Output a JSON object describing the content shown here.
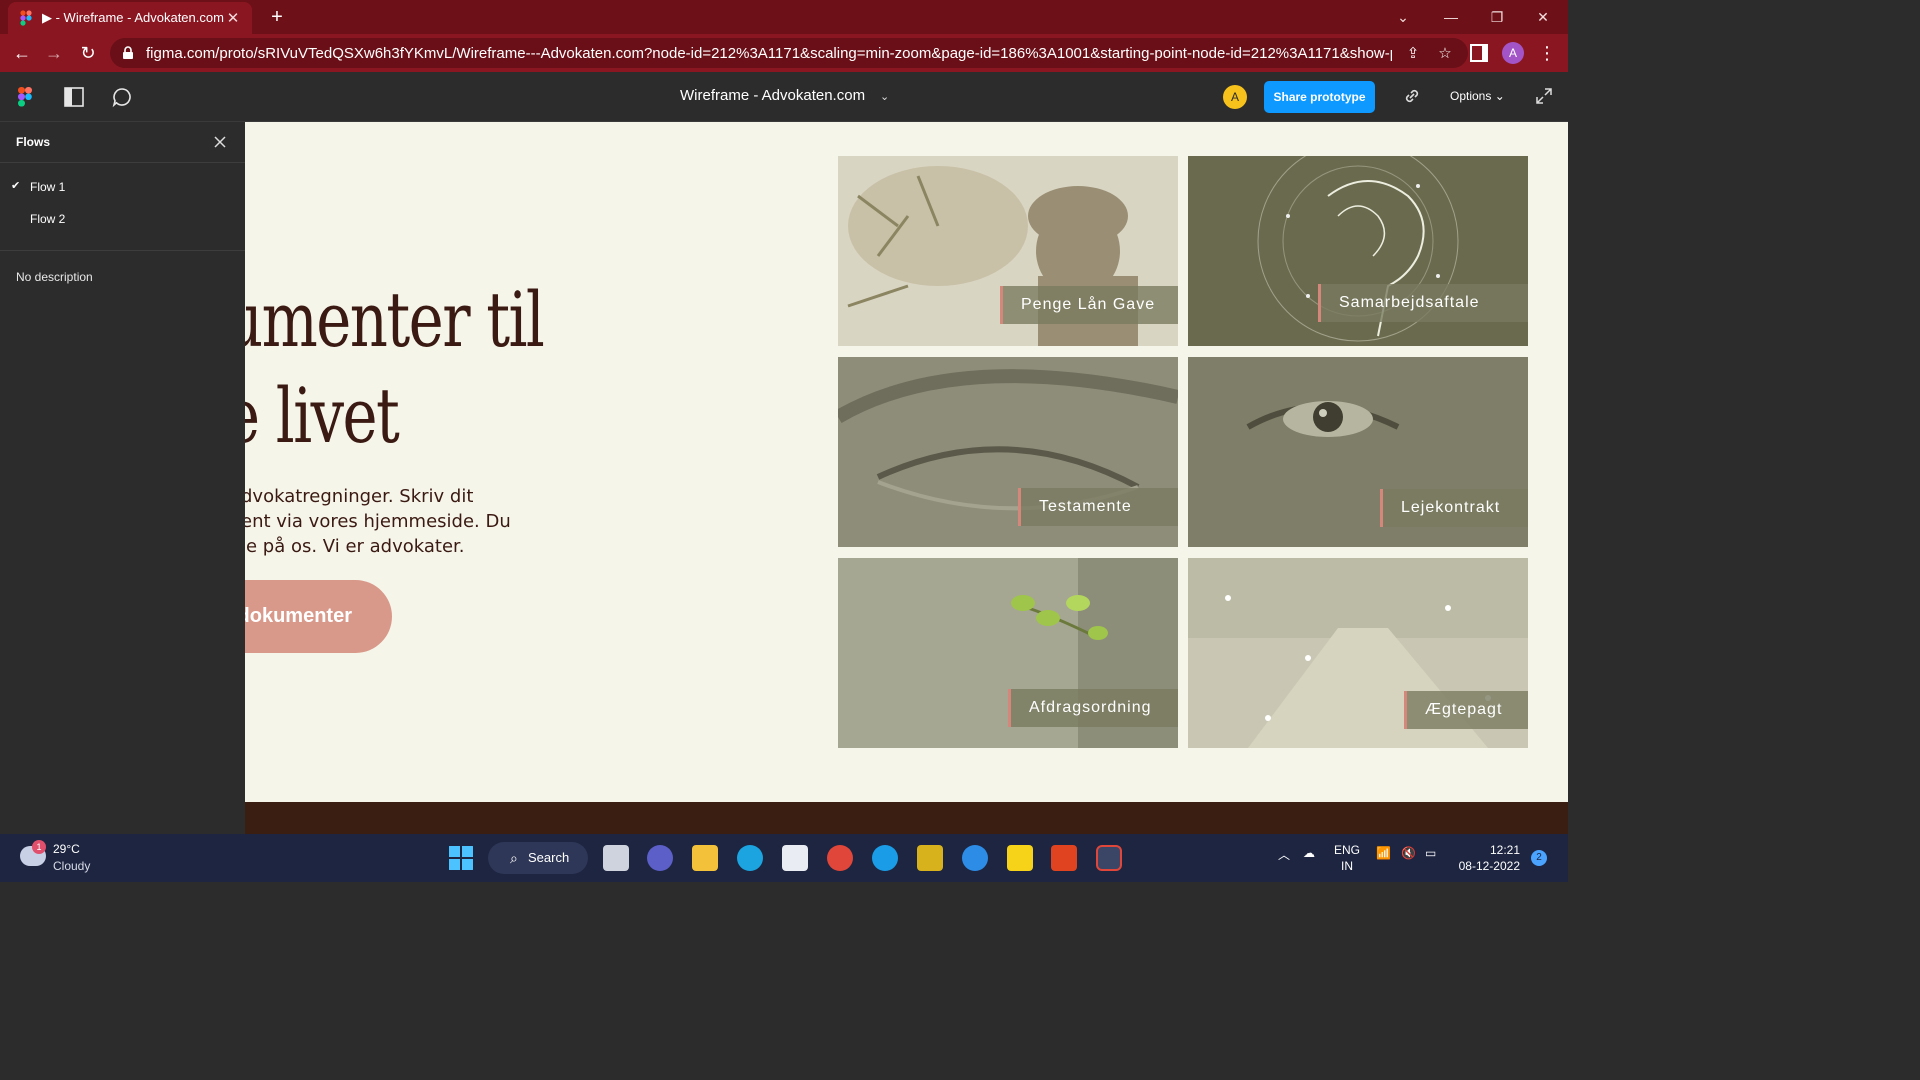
{
  "browser": {
    "tab_title": "▶ - Wireframe - Advokaten.com",
    "url": "figma.com/proto/sRIVuVTedQSXw6h3fYKmvL/Wireframe---Advokaten.com?node-id=212%3A1171&scaling=min-zoom&page-id=186%3A1001&starting-point-node-id=212%3A1171&show-prot...",
    "profile_initial": "A"
  },
  "figma": {
    "project_title": "Wireframe - Advokaten.com",
    "avatar_initial": "A",
    "share_label": "Share prototype",
    "options_label": "Options ⌄"
  },
  "flows": {
    "title": "Flows",
    "items": [
      {
        "label": "Flow 1"
      },
      {
        "label": "Flow 2"
      }
    ],
    "description": "No description"
  },
  "canvas": {
    "heading_line1": "umenter til",
    "heading_line2": "e livet",
    "para_line1": "dvokatregninger. Skriv dit",
    "para_line2": "ent via vores hjemmeside. Du",
    "para_line3": "le på os. Vi er advokater.",
    "cta_label": "dokumenter",
    "tiles": [
      {
        "label": "Penge Lån Gave"
      },
      {
        "label": "Samarbejdsaftale"
      },
      {
        "label": "Testamente"
      },
      {
        "label": "Lejekontrakt"
      },
      {
        "label": "Afdragsordning"
      },
      {
        "label": "Ægtepagt"
      }
    ]
  },
  "taskbar": {
    "weather_temp": "29°C",
    "weather_desc": "Cloudy",
    "weather_badge": "1",
    "search_label": "Search",
    "lang_line1": "ENG",
    "lang_line2": "IN",
    "time": "12:21",
    "date": "08-12-2022",
    "notifications": "2"
  },
  "colors": {
    "browser_frame": "#6e1018",
    "figma_primary": "#0d99ff",
    "canvas_bg": "#f6f5ea",
    "heading": "#3a1a12",
    "cta": "#d9998a",
    "tile_label_bg": "#787a5f",
    "tile_accent": "#d4877a"
  }
}
